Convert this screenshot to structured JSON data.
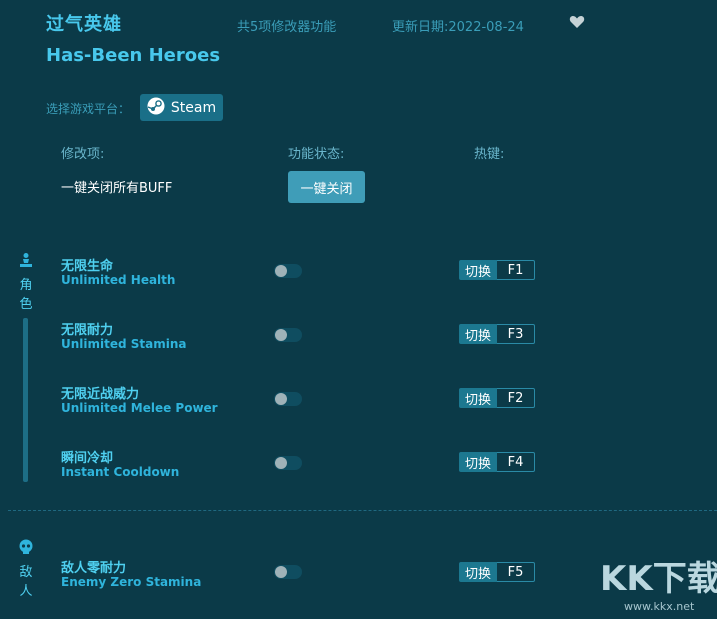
{
  "header": {
    "title_cn": "过气英雄",
    "title_en": "Has-Been Heroes",
    "feature_count": "共5项修改器功能",
    "update_date": "更新日期:2022-08-24"
  },
  "platform": {
    "label": "选择游戏平台：",
    "steam_label": "Steam"
  },
  "columns": {
    "item": "修改项:",
    "status": "功能状态:",
    "hotkey": "热键:"
  },
  "buff": {
    "label": "一键关闭所有BUFF",
    "button": "一键关闭"
  },
  "sections": [
    {
      "name_chars": [
        "角",
        "色"
      ],
      "icon": "pawn-icon",
      "features": [
        {
          "cn": "无限生命",
          "en": "Unlimited Health",
          "switch": "切换",
          "key": "F1",
          "on": false
        },
        {
          "cn": "无限耐力",
          "en": "Unlimited Stamina",
          "switch": "切换",
          "key": "F3",
          "on": false
        },
        {
          "cn": "无限近战威力",
          "en": "Unlimited Melee Power",
          "switch": "切换",
          "key": "F2",
          "on": false
        },
        {
          "cn": "瞬间冷却",
          "en": "Instant Cooldown",
          "switch": "切换",
          "key": "F4",
          "on": false
        }
      ]
    },
    {
      "name_chars": [
        "敌",
        "人"
      ],
      "icon": "skull-icon",
      "features": [
        {
          "cn": "敌人零耐力",
          "en": "Enemy Zero Stamina",
          "switch": "切换",
          "key": "F5",
          "on": false
        }
      ]
    }
  ],
  "watermark": {
    "logo": "KK下载",
    "url": "www.kkx.net"
  },
  "colors": {
    "background": "#0b3a48",
    "accent": "#48c8ec",
    "button": "#3f9db8"
  }
}
